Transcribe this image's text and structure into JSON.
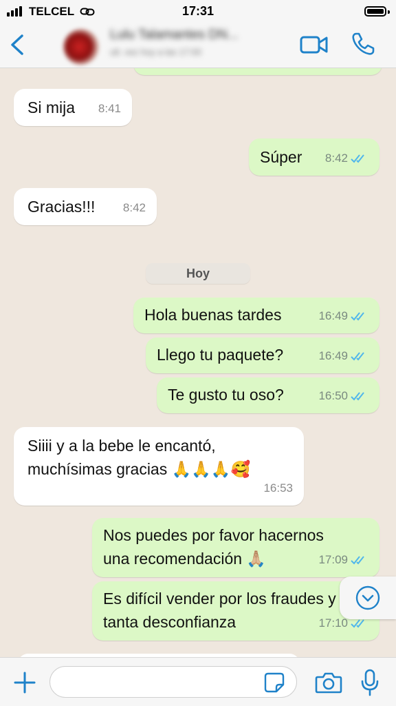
{
  "status": {
    "carrier": "TELCEL",
    "time": "17:31"
  },
  "header": {
    "contact_name": "Lulu Talamantes DN...",
    "contact_subtitle": "ult. vez hoy a las 17:00"
  },
  "chat": {
    "day_separator": "Hoy",
    "messages": [
      {
        "dir": "in",
        "text": "Si mija",
        "time": "8:41"
      },
      {
        "dir": "out",
        "text": "Súper",
        "time": "8:42",
        "read": true
      },
      {
        "dir": "in",
        "text": "Gracias!!!",
        "time": "8:42"
      },
      {
        "dir": "out",
        "text": "Hola buenas tardes",
        "time": "16:49",
        "read": true
      },
      {
        "dir": "out",
        "text": "Llego tu paquete?",
        "time": "16:49",
        "read": true
      },
      {
        "dir": "out",
        "text": "Te gusto tu oso?",
        "time": "16:50",
        "read": true
      },
      {
        "dir": "in",
        "text": "Siiii y a la bebe le encantó,\nmuchísimas gracias 🙏🙏🙏🥰",
        "time": "16:53"
      },
      {
        "dir": "out",
        "text": "Nos puedes por favor hacernos\nuna recomendación 🙏🏼",
        "time": "17:09",
        "read": true
      },
      {
        "dir": "out",
        "text": "Es difícil vender por los fraudes y\ntanta desconfianza",
        "time": "17:10",
        "read": true
      }
    ]
  },
  "composer": {
    "input_value": "",
    "input_placeholder": ""
  },
  "colors": {
    "accent": "#1f82c9",
    "outgoing_bubble": "#dcf8c6",
    "incoming_bubble": "#ffffff",
    "read_check": "#4fb6ec",
    "chat_background": "#efe7de"
  },
  "icons": {
    "back": "chevron-left-icon",
    "video": "video-camera-icon",
    "call": "phone-icon",
    "plus": "plus-icon",
    "sticker": "sticker-icon",
    "camera": "camera-icon",
    "mic": "microphone-icon",
    "scroll": "chevron-down-icon",
    "read": "double-check-icon"
  }
}
